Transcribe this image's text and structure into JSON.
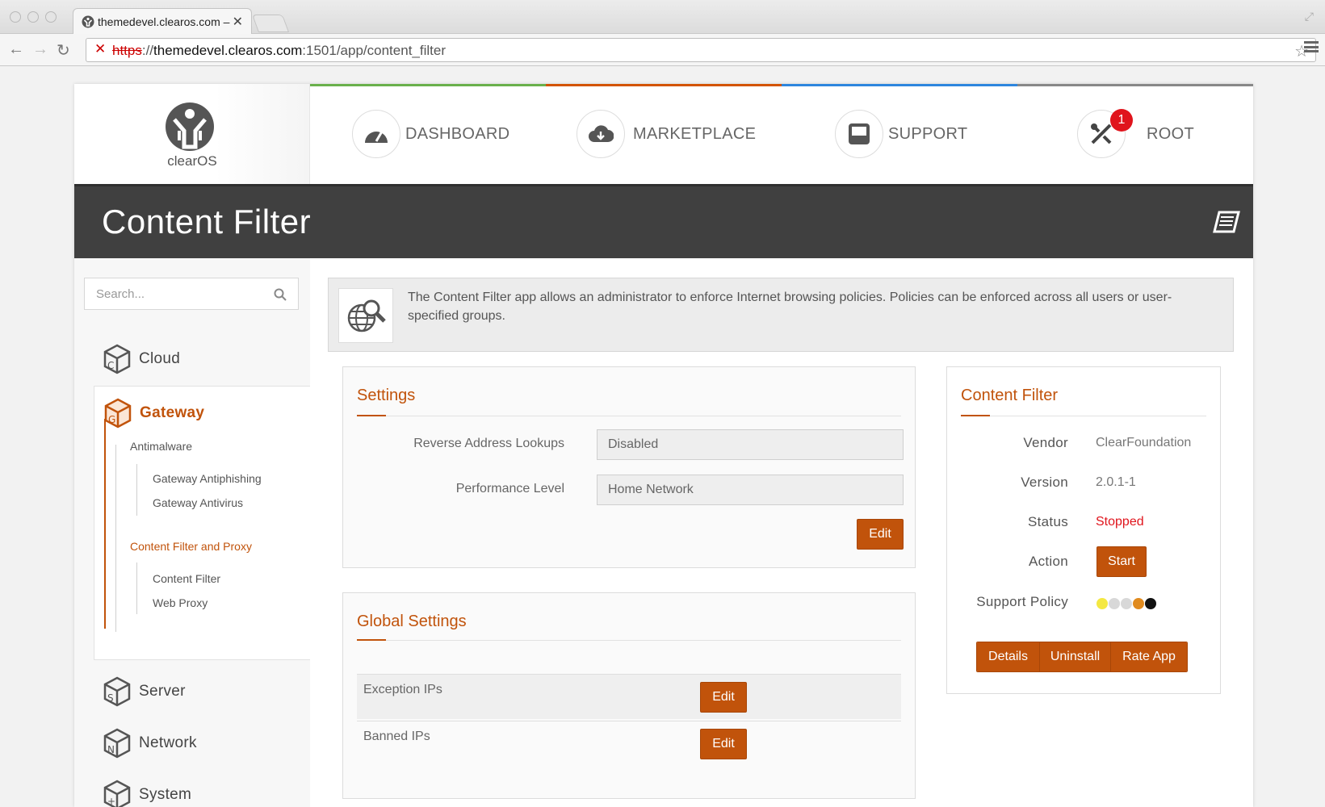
{
  "browser": {
    "tab_title": "themedevel.clearos.com –",
    "url_protocol": "https",
    "url_separator": "://",
    "url_host": "themedevel.clearos.com",
    "url_rest": ":1501/app/content_filter"
  },
  "header": {
    "logo_text": "clearOS",
    "nav": [
      {
        "label": "DASHBOARD",
        "icon": "speedometer-icon"
      },
      {
        "label": "MARKETPLACE",
        "icon": "cloud-download-icon"
      },
      {
        "label": "SUPPORT",
        "icon": "inbox-icon"
      },
      {
        "label": "ROOT",
        "icon": "tools-icon",
        "badge": "1"
      }
    ],
    "stripe_colors": [
      "#2c2c2c",
      "#6ab04c",
      "#d35400",
      "#2e86de",
      "#888888"
    ]
  },
  "title": {
    "text": "Content Filter",
    "help_icon": "book-icon"
  },
  "sidebar": {
    "search_placeholder": "Search...",
    "categories": {
      "cloud": "Cloud",
      "gateway": "Gateway",
      "server": "Server",
      "network": "Network",
      "system": "System"
    },
    "gateway_sub": {
      "antimalware": "Antimalware",
      "antiphishing": "Gateway Antiphishing",
      "antivirus": "Gateway Antivirus",
      "content_proxy": "Content Filter and Proxy",
      "content_filter": "Content Filter",
      "web_proxy": "Web Proxy"
    }
  },
  "intro": {
    "text": "The Content Filter app allows an administrator to enforce Internet browsing policies. Policies can be enforced across all users or user-specified groups."
  },
  "settings": {
    "title": "Settings",
    "fields": [
      {
        "label": "Reverse Address Lookups",
        "value": "Disabled"
      },
      {
        "label": "Performance Level",
        "value": "Home Network"
      }
    ],
    "edit_label": "Edit"
  },
  "global_settings": {
    "title": "Global Settings",
    "rows": [
      {
        "label": "Exception IPs",
        "button": "Edit"
      },
      {
        "label": "Banned IPs",
        "button": "Edit"
      }
    ]
  },
  "app_info": {
    "title": "Content Filter",
    "vendor_label": "Vendor",
    "vendor": "ClearFoundation",
    "version_label": "Version",
    "version": "2.0.1-1",
    "status_label": "Status",
    "status": "Stopped",
    "status_color": "#e0141c",
    "action_label": "Action",
    "action_button": "Start",
    "support_label": "Support Policy",
    "support_dots": [
      "#f4e842",
      "#d8d8d8",
      "#d8d8d8",
      "#e08a1e",
      "#111111"
    ],
    "buttons": [
      "Details",
      "Uninstall",
      "Rate App"
    ]
  },
  "accent_color": "#c1530b"
}
